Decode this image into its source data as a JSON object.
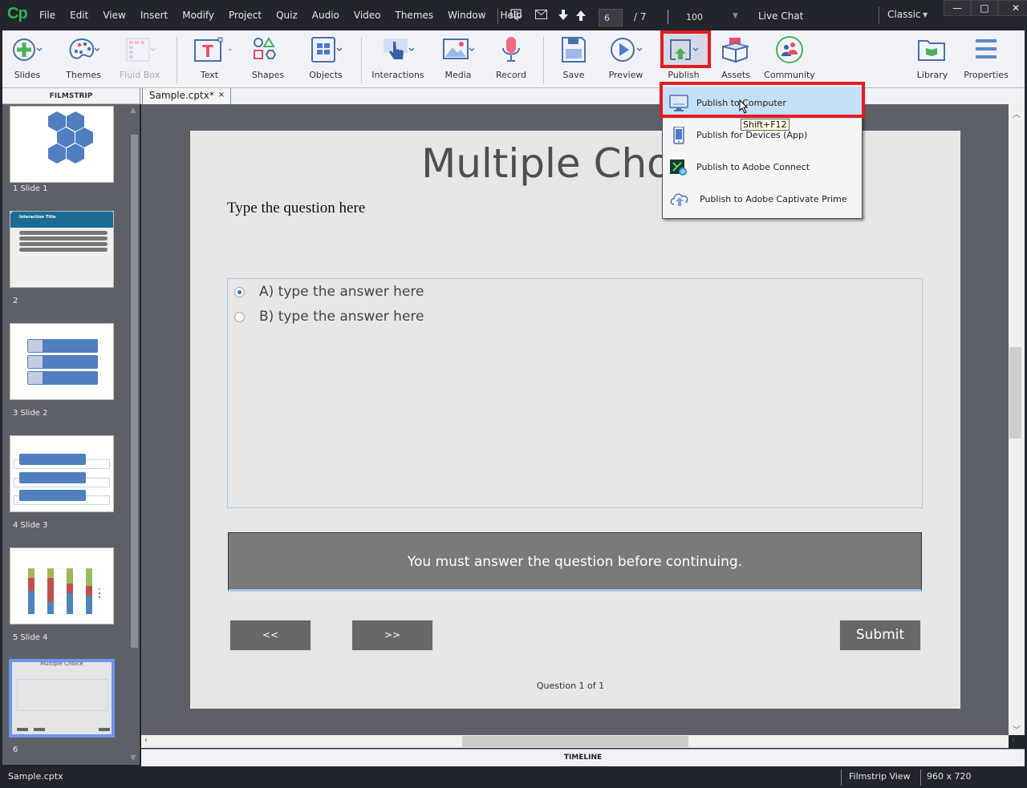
{
  "app": {
    "logo": "Cp",
    "title": "Adobe Captivate"
  },
  "menu": [
    "File",
    "Edit",
    "View",
    "Insert",
    "Modify",
    "Project",
    "Quiz",
    "Audio",
    "Video",
    "Themes",
    "Window",
    "Help"
  ],
  "titlebar": {
    "current_slide": "6",
    "slide_total": "/   7",
    "zoom": "100",
    "live_chat": "Live Chat",
    "workspace": "Classic",
    "minimize": "—",
    "maximize": "□",
    "close": "✕"
  },
  "toolbar": {
    "slides": "Slides",
    "themes": "Themes",
    "fluid_box": "Fluid Box",
    "text": "Text",
    "shapes": "Shapes",
    "objects": "Objects",
    "interactions": "Interactions",
    "media": "Media",
    "record": "Record",
    "save": "Save",
    "preview": "Preview",
    "publish": "Publish",
    "assets": "Assets",
    "community": "Community",
    "library": "Library",
    "properties": "Properties"
  },
  "panels": {
    "filmstrip": "FILMSTRIP",
    "doc_tab": "Sample.cptx*",
    "doc_tab_close": "×",
    "timeline": "TIMELINE"
  },
  "filmstrip": {
    "slides": [
      {
        "label": "1 Slide 1"
      },
      {
        "label": "2"
      },
      {
        "label": "3 Slide 2"
      },
      {
        "label": "4 Slide 3"
      },
      {
        "label": "5 Slide 4"
      },
      {
        "label": "6",
        "selected": true
      }
    ],
    "thumb2_title": "Interaction Title",
    "thumb6_title": "Multiple Choice"
  },
  "slide": {
    "title": "Multiple Choice",
    "question": "Type the question here",
    "answers": [
      {
        "label": "A) type the answer here",
        "selected": true
      },
      {
        "label": "B) type the answer here",
        "selected": false
      }
    ],
    "message": "You must answer the question before continuing.",
    "back_button": "<<",
    "next_button": ">>",
    "submit_button": "Submit",
    "question_count": "Question 1 of 1"
  },
  "publish_menu": {
    "items": [
      {
        "label": "Publish to Computer",
        "icon": "monitor-icon",
        "active": true
      },
      {
        "label": "Publish for Devices (App)",
        "icon": "mobile-device-icon"
      },
      {
        "label": "Publish to Adobe Connect",
        "icon": "adobe-connect-icon"
      },
      {
        "label": "Publish to Adobe Captivate Prime",
        "icon": "cloud-upload-icon"
      }
    ],
    "tooltip": "Shift+F12"
  },
  "statusbar": {
    "file": "Sample.cptx",
    "view": "Filmstrip View",
    "dimensions": "960 x 720"
  },
  "colors": {
    "accent_highlight": "#e21c23",
    "brand_green": "#33b15a",
    "selection_blue": "#6b96f0"
  }
}
